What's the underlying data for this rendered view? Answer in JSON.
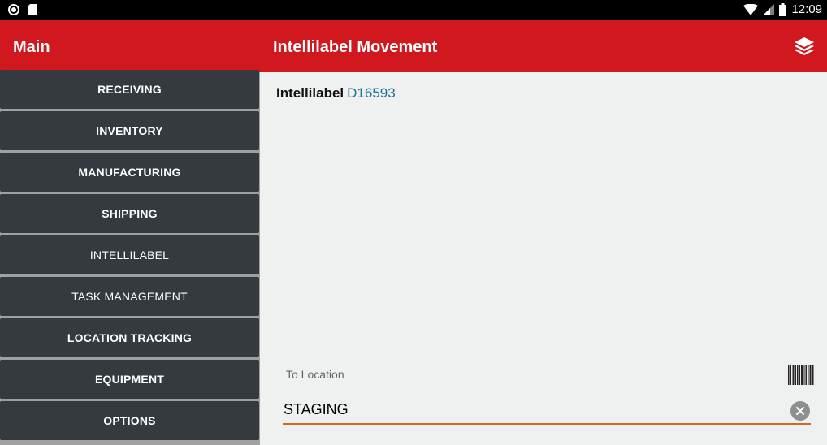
{
  "status_bar": {
    "time": "12:09",
    "icons": [
      "record-icon",
      "sd-card-icon",
      "wifi-icon",
      "cell-signal-icon",
      "battery-icon"
    ]
  },
  "app_bar": {
    "nav_title": "Main",
    "title": "Intellilabel Movement",
    "action_icon": "layers-icon",
    "color": "#d0181e"
  },
  "sidebar": {
    "items": [
      {
        "label": "RECEIVING"
      },
      {
        "label": "INVENTORY"
      },
      {
        "label": "MANUFACTURING"
      },
      {
        "label": "SHIPPING"
      },
      {
        "label": "INTELLILABEL"
      },
      {
        "label": "TASK MANAGEMENT"
      },
      {
        "label": "LOCATION TRACKING"
      },
      {
        "label": "EQUIPMENT"
      },
      {
        "label": "OPTIONS"
      }
    ],
    "item_color": "#343a3d"
  },
  "main": {
    "intellilabel_label": "Intellilabel",
    "intellilabel_value": "D16593",
    "to_location_label": "To Location",
    "to_location_value": "STAGING",
    "accent_color": "#d2691e",
    "link_color": "#1e6e9c"
  }
}
